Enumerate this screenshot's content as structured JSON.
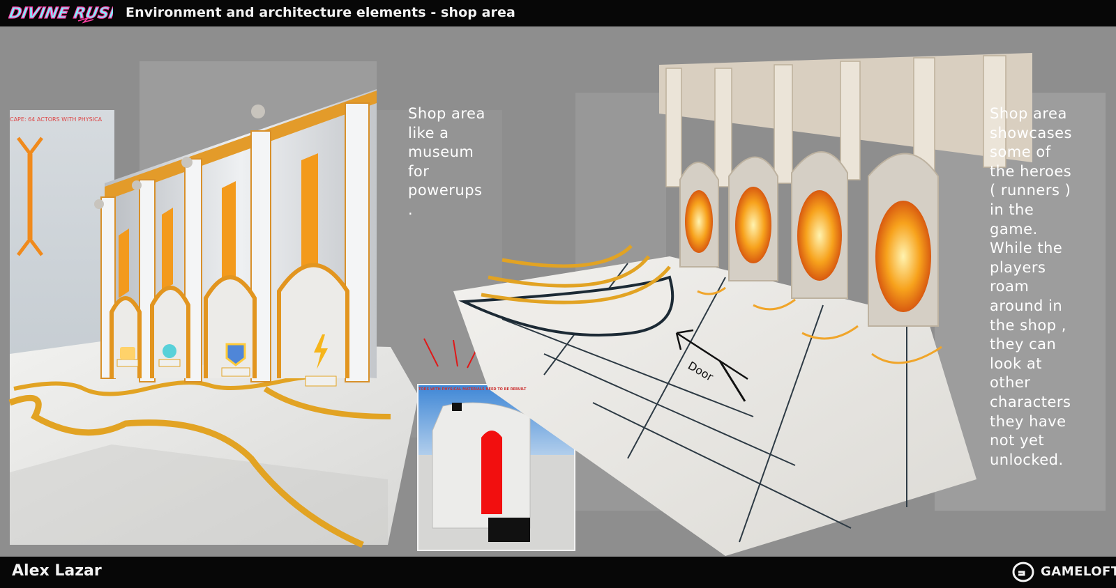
{
  "header": {
    "logo_text": "DIVINE RUSH",
    "title": "Environment and architecture elements - shop area"
  },
  "notes": {
    "left": "Shop area\nlike a\nmuseum\nfor\npowerups\n.",
    "right": "Shop area\nshowcases\nsome of\nthe heroes\n( runners )\nin the\ngame.\nWhile the\nplayers\nroam\naround in\nthe shop ,\nthey can\nlook at\nother\ncharacters\nthey have\nnot yet\nunlocked."
  },
  "annotations": {
    "door_label": "Door"
  },
  "footer": {
    "author": "Alex Lazar",
    "brand": "GAMELOFT"
  },
  "colors": {
    "bar": "#070707",
    "background": "#8e8e8e",
    "gold": "#e2a323",
    "orange_glow": "#f39a1c",
    "marble": "#e7e7e5"
  }
}
